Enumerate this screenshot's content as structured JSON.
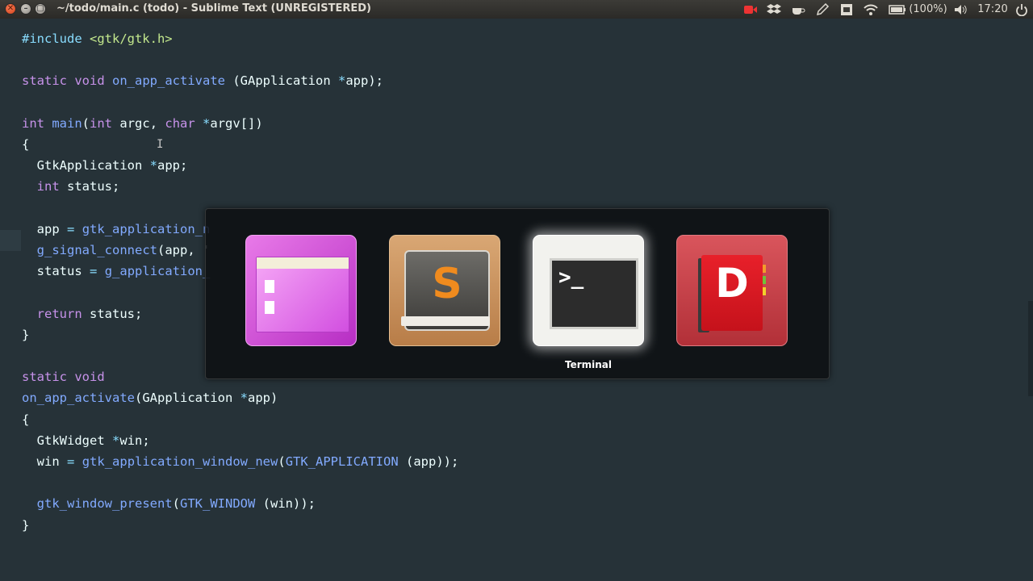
{
  "window": {
    "title": "~/todo/main.c (todo) - Sublime Text (UNREGISTERED)",
    "close_glyph": "✕",
    "min_glyph": "–",
    "max_glyph": "▢"
  },
  "tray": {
    "battery": "(100%)",
    "clock": "17:20",
    "icons": [
      "record-icon",
      "dropbox-icon",
      "coffee-icon",
      "pencil-icon",
      "screenshot-icon",
      "wifi-icon",
      "battery-icon",
      "volume-icon",
      "power-icon"
    ]
  },
  "code": {
    "lines": [
      "#include <gtk/gtk.h>",
      "",
      "static void on_app_activate (GApplication *app);",
      "",
      "int main(int argc, char *argv[])",
      "{",
      "  GtkApplication *app;",
      "  int status;",
      "",
      "  app = gtk_application_n",
      "  g_signal_connect(app, '",
      "  status = g_application_",
      "",
      "  return status;",
      "}",
      "",
      "static void",
      "on_app_activate(GApplication *app)",
      "{",
      "  GtkWidget *win;",
      "  win = gtk_application_window_new(GTK_APPLICATION (app));",
      "",
      "  gtk_window_present(GTK_WINDOW (win));",
      "}"
    ]
  },
  "switcher": {
    "apps": [
      {
        "name": "files-app-icon"
      },
      {
        "name": "sublime-text-app-icon",
        "glyph": "S"
      },
      {
        "name": "terminal-app-icon",
        "glyph": ">_"
      },
      {
        "name": "dictionary-app-icon",
        "glyph": "D"
      }
    ],
    "selected_label": "Terminal"
  },
  "colors": {
    "editor_bg": "#263238",
    "keyword": "#c792ea",
    "function": "#82aaff",
    "string": "#c3e88d"
  }
}
